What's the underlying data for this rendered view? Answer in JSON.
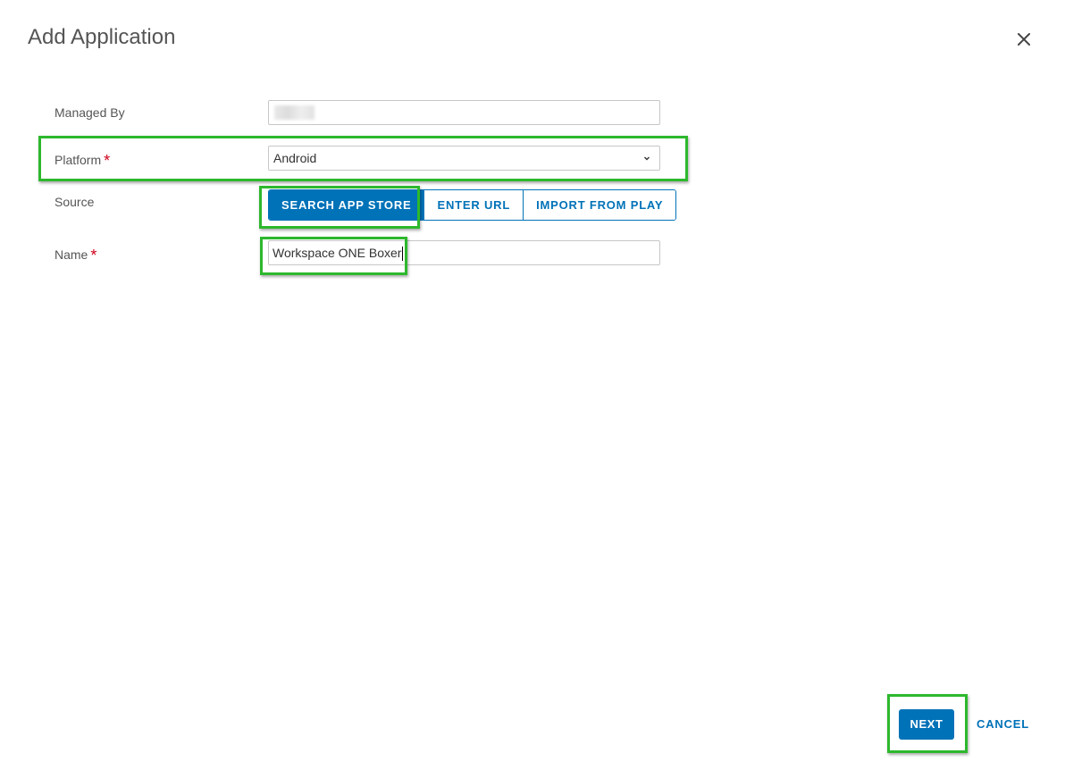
{
  "dialog": {
    "title": "Add Application",
    "close_icon": "close-icon"
  },
  "form": {
    "managed_by": {
      "label": "Managed By",
      "value": ""
    },
    "platform": {
      "label": "Platform",
      "required_mark": "*",
      "value": "Android",
      "icon": "chevron-down-icon"
    },
    "source": {
      "label": "Source",
      "options": [
        {
          "label": "SEARCH APP STORE",
          "selected": true
        },
        {
          "label": "ENTER URL",
          "selected": false
        },
        {
          "label": "IMPORT FROM PLAY",
          "selected": false
        }
      ]
    },
    "name": {
      "label": "Name",
      "required_mark": "*",
      "value": "Workspace ONE Boxer"
    }
  },
  "footer": {
    "next_label": "NEXT",
    "cancel_label": "CANCEL"
  },
  "colors": {
    "accent": "#0072b8",
    "required": "#d0021b",
    "highlight": "#2db82d"
  }
}
